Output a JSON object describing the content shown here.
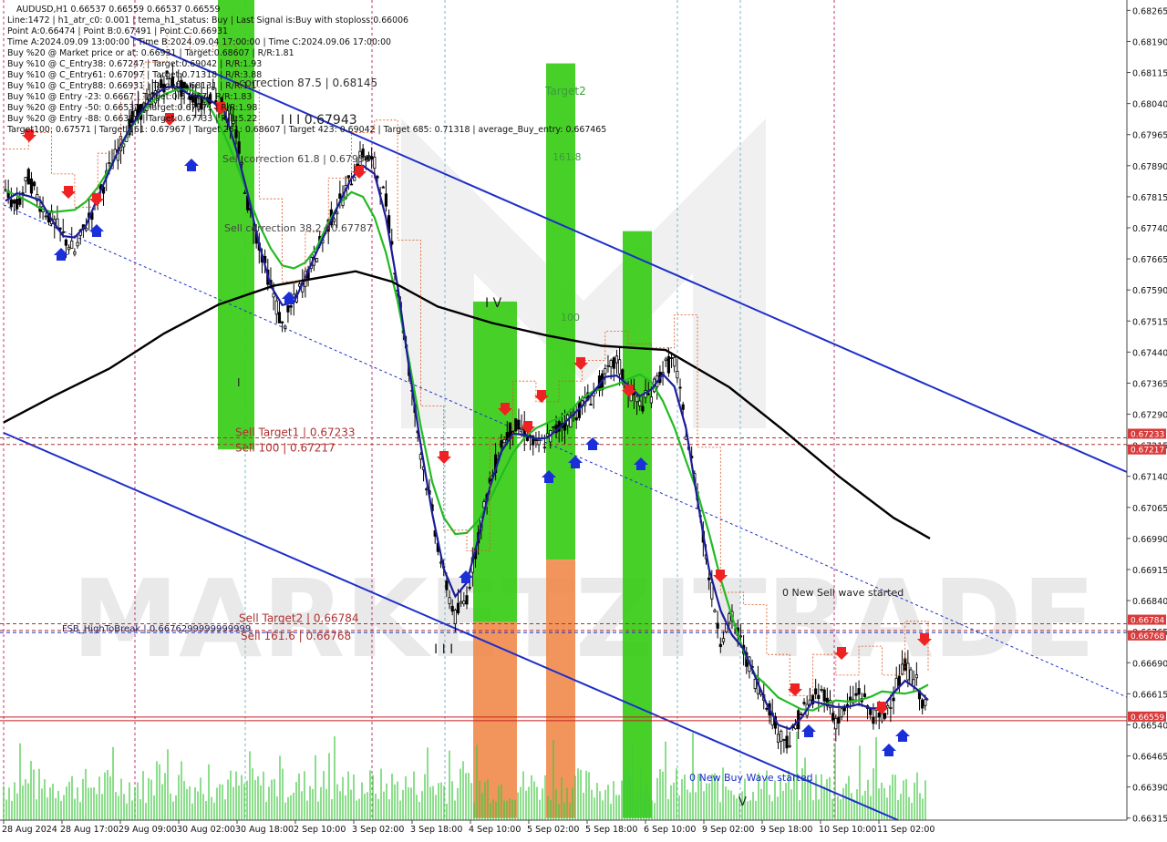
{
  "chart_data": {
    "type": "line",
    "symbol": "AUDUSD",
    "timeframe": "H1",
    "header_lines": [
      "AUDUSD,H1  0.66537 0.66559 0.66537 0.66559",
      "Line:1472 | h1_atr_c0: 0.001 | tema_h1_status: Buy | Last Signal is:Buy with stoploss:0.66006",
      "Point A:0.66474 | Point B:0.67491 | Point C:0.66931",
      "Time A:2024.09.09 13:00:00 | Time B:2024.09.04 17:00:00 | Time C:2024.09.06 17:00:00",
      "Buy %20 @ Market price or at: 0.66931 | Target:0.68607 | R/R:1.81",
      "Buy %10 @ C_Entry38: 0.67247 | Target:0.69042 | R/R:1.93",
      "Buy %10 @ C_Entry61: 0.67097 | Target:0.71318 | R/R:3.88",
      "Buy %10 @ C_Entry88: 0.66931 | Target:0.68131 | R/R:1.1",
      "Buy %10 @ Entry -23: 0.6667 | Target:0.67967 | R/R:1.83",
      "Buy %20 @ Entry -50: 0.66537 | Target:0.67571 | R/R:1.98",
      "Buy %20 @ Entry -88: 0.66384 | Target:0.67733 | R/R:5.22",
      "Target100: 0.67571 | Target 161: 0.67967 | Target 261: 0.68607 | Target 423: 0.69042 | Target 685: 0.71318 | average_Buy_entry: 0.667465"
    ],
    "y_axis": {
      "ticks": [
        "0.68265",
        "0.68190",
        "0.68115",
        "0.68040",
        "0.67965",
        "0.67890",
        "0.67815",
        "0.67740",
        "0.67665",
        "0.67590",
        "0.67515",
        "0.67440",
        "0.67365",
        "0.67290",
        "0.67215",
        "0.67140",
        "0.67065",
        "0.66990",
        "0.66915",
        "0.66840",
        "0.66765",
        "0.66690",
        "0.66615",
        "0.66540",
        "0.66465",
        "0.66390",
        "0.66315"
      ],
      "range": [
        0.6631,
        0.6829
      ]
    },
    "x_axis": {
      "ticks": [
        "28 Aug 2024",
        "28 Aug 17:00",
        "29 Aug 09:00",
        "30 Aug 02:00",
        "30 Aug 18:00",
        "2 Sep 10:00",
        "3 Sep 02:00",
        "3 Sep 18:00",
        "4 Sep 10:00",
        "5 Sep 02:00",
        "5 Sep 18:00",
        "6 Sep 10:00",
        "9 Sep 02:00",
        "9 Sep 18:00",
        "10 Sep 10:00",
        "11 Sep 02:00"
      ]
    },
    "price_tags": [
      {
        "value": "0.67233",
        "color": "#d93a3a"
      },
      {
        "value": "0.67217",
        "color": "#d93a3a"
      },
      {
        "value": "0.66784",
        "color": "#d93a3a"
      },
      {
        "value": "0.66768",
        "color": "#d93a3a"
      },
      {
        "value": "0.66559",
        "color": "#d93a3a"
      }
    ],
    "horizontal_levels": [
      {
        "price": 0.67233,
        "label": "Sell Target1 | 0.67233",
        "color": "#b03030",
        "style": "dashed"
      },
      {
        "price": 0.67217,
        "label": "Sell 100 | 0.67217",
        "color": "#b03030",
        "style": "dashed"
      },
      {
        "price": 0.66784,
        "label": "Sell Target2 | 0.66784",
        "color": "#b03030",
        "style": "dashed"
      },
      {
        "price": 0.66768,
        "label": "Sell 161.6 | 0.66768",
        "color": "#b03030",
        "style": "dashed"
      },
      {
        "price": 0.667629999999999,
        "label": "FSB_HighToBreak | 0.6676299999999999",
        "color": "#1c2fc8",
        "style": "dashed"
      },
      {
        "price": 0.66559,
        "label": "",
        "color": "#c81e1e",
        "style": "solid"
      },
      {
        "price": 0.6655,
        "label": "",
        "color": "#c81e1e",
        "style": "solid"
      }
    ],
    "annotations": [
      "correction 87.5 | 0.68145",
      "I I I  0.67943",
      "Sell correction 61.8 | 0.67959",
      "Sell correction 38.2 | 0.67787",
      "I V",
      "I",
      "I I I",
      "V",
      "Target2",
      "161.8",
      "100",
      "0 New Sell wave started",
      "0 New Buy Wave started"
    ],
    "close_series": {
      "name": "",
      "values": [
        0.6782,
        0.6779,
        0.6786,
        0.678,
        0.6776,
        0.6772,
        0.6768,
        0.6775,
        0.6781,
        0.6788,
        0.6794,
        0.68,
        0.6803,
        0.6806,
        0.681,
        0.6808,
        0.6806,
        0.6804,
        0.6807,
        0.6802,
        0.6797,
        0.678,
        0.677,
        0.676,
        0.675,
        0.6756,
        0.6762,
        0.6768,
        0.6775,
        0.678,
        0.6786,
        0.6792,
        0.6789,
        0.678,
        0.676,
        0.674,
        0.672,
        0.6705,
        0.669,
        0.668,
        0.6685,
        0.67,
        0.6712,
        0.6722,
        0.6726,
        0.6725,
        0.6721,
        0.6723,
        0.6726,
        0.6728,
        0.6731,
        0.6734,
        0.6738,
        0.6742,
        0.6735,
        0.6731,
        0.6734,
        0.674,
        0.6742,
        0.6725,
        0.671,
        0.669,
        0.6675,
        0.668,
        0.6672,
        0.6665,
        0.666,
        0.6652,
        0.665,
        0.6657,
        0.666,
        0.6662,
        0.6655,
        0.6658,
        0.6662,
        0.6657,
        0.6655,
        0.6662,
        0.6668,
        0.6664,
        0.6656
      ]
    }
  },
  "colors": {
    "candle": "#000000",
    "tema_fast": "#1c1c9a",
    "ema_green": "#22bb22",
    "sma_black": "#000000",
    "channel": "#1c2fc8",
    "zone_green": "#33cc11",
    "zone_orange": "#f08a4b",
    "sell_arrow": "#ee2222",
    "buy_arrow": "#1a2fd8",
    "watermark": "#d4d4d4",
    "grid": "#c8c8c8"
  }
}
